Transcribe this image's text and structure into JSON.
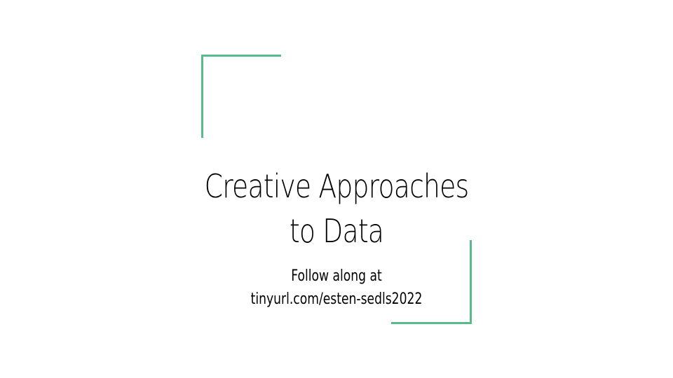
{
  "slide": {
    "title_lines": [
      "Creative Approaches",
      "to Data"
    ],
    "subtitle_lines": [
      "Follow along at",
      "tinyurl.com/esten-sedls2022"
    ],
    "accent_color": "#57bb8a"
  }
}
